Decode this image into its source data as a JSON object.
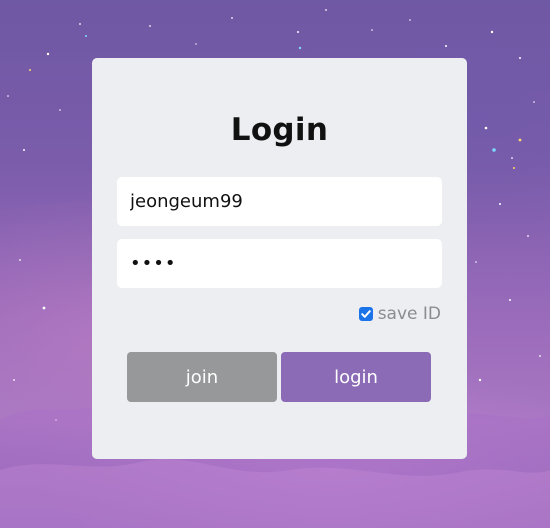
{
  "login_card": {
    "title": "Login",
    "username_value": "jeongeum99",
    "password_value": "••••",
    "save_id_label": "save ID",
    "save_id_checked": true,
    "join_label": "join",
    "login_label": "login"
  },
  "colors": {
    "card_background": "#eceef1",
    "join_button": "#979899",
    "login_button": "#8b6bb5",
    "checkbox": "#1a73e8"
  }
}
